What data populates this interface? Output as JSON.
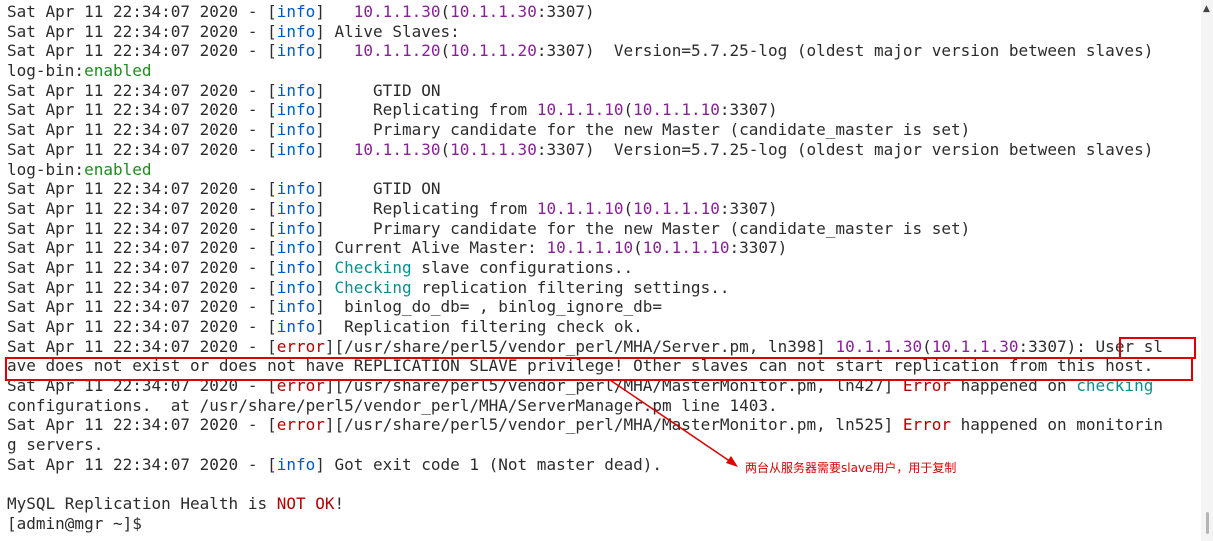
{
  "annotation_note": "两台从服务器需要slave用户，用于复制",
  "colors": {
    "info": "#0059c9",
    "error": "#b80000",
    "ip": "#8a1f9a",
    "enabled": "#1a8f1a",
    "checking": "#0a8f8f",
    "annotation": "#e00000"
  },
  "lines": [
    [
      [
        "Sat Apr 11 22:34:07 2020 - [",
        ""
      ],
      [
        "info",
        "b"
      ],
      [
        "]   ",
        ""
      ],
      [
        "10.1.1.30",
        "p"
      ],
      [
        "(",
        ""
      ],
      [
        "10.1.1.30",
        "p"
      ],
      [
        ":3307)",
        ""
      ]
    ],
    [
      [
        "Sat Apr 11 22:34:07 2020 - [",
        ""
      ],
      [
        "info",
        "b"
      ],
      [
        "] Alive Slaves:",
        ""
      ]
    ],
    [
      [
        "Sat Apr 11 22:34:07 2020 - [",
        ""
      ],
      [
        "info",
        "b"
      ],
      [
        "]   ",
        ""
      ],
      [
        "10.1.1.20",
        "p"
      ],
      [
        "(",
        ""
      ],
      [
        "10.1.1.20",
        "p"
      ],
      [
        ":3307)  Version=5.7.25-log (oldest major version between slaves)",
        ""
      ]
    ],
    [
      [
        "log-bin:",
        ""
      ],
      [
        "enabled",
        "g"
      ]
    ],
    [
      [
        "Sat Apr 11 22:34:07 2020 - [",
        ""
      ],
      [
        "info",
        "b"
      ],
      [
        "]     GTID ON",
        ""
      ]
    ],
    [
      [
        "Sat Apr 11 22:34:07 2020 - [",
        ""
      ],
      [
        "info",
        "b"
      ],
      [
        "]     Replicating from ",
        ""
      ],
      [
        "10.1.1.10",
        "p"
      ],
      [
        "(",
        ""
      ],
      [
        "10.1.1.10",
        "p"
      ],
      [
        ":3307)",
        ""
      ]
    ],
    [
      [
        "Sat Apr 11 22:34:07 2020 - [",
        ""
      ],
      [
        "info",
        "b"
      ],
      [
        "]     Primary candidate for the new Master (candidate_master is set)",
        ""
      ]
    ],
    [
      [
        "Sat Apr 11 22:34:07 2020 - [",
        ""
      ],
      [
        "info",
        "b"
      ],
      [
        "]   ",
        ""
      ],
      [
        "10.1.1.30",
        "p"
      ],
      [
        "(",
        ""
      ],
      [
        "10.1.1.30",
        "p"
      ],
      [
        ":3307)  Version=5.7.25-log (oldest major version between slaves)",
        ""
      ]
    ],
    [
      [
        "log-bin:",
        ""
      ],
      [
        "enabled",
        "g"
      ]
    ],
    [
      [
        "Sat Apr 11 22:34:07 2020 - [",
        ""
      ],
      [
        "info",
        "b"
      ],
      [
        "]     GTID ON",
        ""
      ]
    ],
    [
      [
        "Sat Apr 11 22:34:07 2020 - [",
        ""
      ],
      [
        "info",
        "b"
      ],
      [
        "]     Replicating from ",
        ""
      ],
      [
        "10.1.1.10",
        "p"
      ],
      [
        "(",
        ""
      ],
      [
        "10.1.1.10",
        "p"
      ],
      [
        ":3307)",
        ""
      ]
    ],
    [
      [
        "Sat Apr 11 22:34:07 2020 - [",
        ""
      ],
      [
        "info",
        "b"
      ],
      [
        "]     Primary candidate for the new Master (candidate_master is set)",
        ""
      ]
    ],
    [
      [
        "Sat Apr 11 22:34:07 2020 - [",
        ""
      ],
      [
        "info",
        "b"
      ],
      [
        "] Current Alive Master: ",
        ""
      ],
      [
        "10.1.1.10",
        "p"
      ],
      [
        "(",
        ""
      ],
      [
        "10.1.1.10",
        "p"
      ],
      [
        ":3307)",
        ""
      ]
    ],
    [
      [
        "Sat Apr 11 22:34:07 2020 - [",
        ""
      ],
      [
        "info",
        "b"
      ],
      [
        "] ",
        ""
      ],
      [
        "Checking",
        "c"
      ],
      [
        " slave configurations..",
        ""
      ]
    ],
    [
      [
        "Sat Apr 11 22:34:07 2020 - [",
        ""
      ],
      [
        "info",
        "b"
      ],
      [
        "] ",
        ""
      ],
      [
        "Checking",
        "c"
      ],
      [
        " replication filtering settings..",
        ""
      ]
    ],
    [
      [
        "Sat Apr 11 22:34:07 2020 - [",
        ""
      ],
      [
        "info",
        "b"
      ],
      [
        "]  binlog_do_db= , binlog_ignore_db=",
        ""
      ]
    ],
    [
      [
        "Sat Apr 11 22:34:07 2020 - [",
        ""
      ],
      [
        "info",
        "b"
      ],
      [
        "]  Replication filtering check ok.",
        ""
      ]
    ],
    [
      [
        "Sat Apr 11 22:34:07 2020 - [",
        ""
      ],
      [
        "error",
        "r"
      ],
      [
        "][/usr/share/perl5/vendor_perl/MHA/Server.pm, ln398] ",
        ""
      ],
      [
        "10.1.1.30",
        "p"
      ],
      [
        "(",
        ""
      ],
      [
        "10.1.1.30",
        "p"
      ],
      [
        ":3307): User sl",
        ""
      ]
    ],
    [
      [
        "ave does not exist or does not have REPLICATION SLAVE privilege! Other slaves can not start replication from this host.",
        ""
      ]
    ],
    [
      [
        "Sat Apr 11 22:34:07 2020 - [",
        ""
      ],
      [
        "error",
        "r"
      ],
      [
        "][/usr/share/perl5/vendor_perl/MHA/MasterMonitor.pm, ln427] ",
        ""
      ],
      [
        "Error",
        "r"
      ],
      [
        " happened on ",
        ""
      ],
      [
        "checking",
        "c"
      ]
    ],
    [
      [
        "configurations.  at /usr/share/perl5/vendor_perl/MHA/ServerManager.pm line 1403.",
        ""
      ]
    ],
    [
      [
        "Sat Apr 11 22:34:07 2020 - [",
        ""
      ],
      [
        "error",
        "r"
      ],
      [
        "][/usr/share/perl5/vendor_perl/MHA/MasterMonitor.pm, ln525] ",
        ""
      ],
      [
        "Error",
        "r"
      ],
      [
        " happened on monitorin",
        ""
      ]
    ],
    [
      [
        "g servers.",
        ""
      ]
    ],
    [
      [
        "Sat Apr 11 22:34:07 2020 - [",
        ""
      ],
      [
        "info",
        "b"
      ],
      [
        "] Got exit code 1 (Not master dead).",
        ""
      ]
    ],
    [
      [
        "",
        ""
      ]
    ],
    [
      [
        "MySQL Replication Health is ",
        ""
      ],
      [
        "NOT OK",
        "r"
      ],
      [
        "!",
        ""
      ]
    ],
    [
      [
        "[admin@mgr ~]$ ",
        ""
      ]
    ]
  ]
}
